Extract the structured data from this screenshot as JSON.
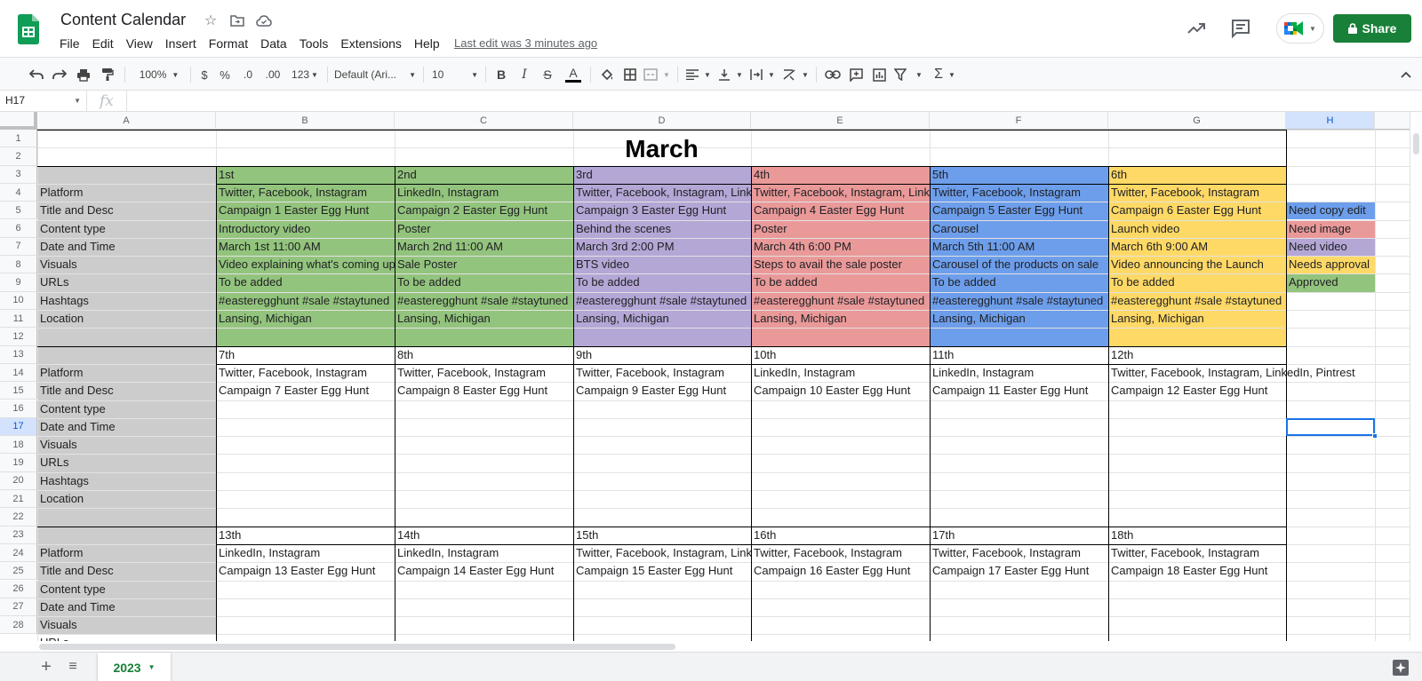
{
  "header": {
    "doc_title": "Content Calendar",
    "last_edit": "Last edit was 3 minutes ago",
    "share_label": "Share",
    "menu": [
      "File",
      "Edit",
      "View",
      "Insert",
      "Format",
      "Data",
      "Tools",
      "Extensions",
      "Help"
    ]
  },
  "toolbar": {
    "zoom": "100%",
    "currency": "$",
    "percent": "%",
    "dec_decrease": ".0",
    "dec_increase": ".00",
    "more_formats": "123",
    "font": "Default (Ari...",
    "font_size": "10",
    "bold": "B",
    "italic": "I",
    "strike": "S",
    "text_color": "A"
  },
  "formula_bar": {
    "cell_ref": "H17",
    "fx": "fx",
    "value": ""
  },
  "grid": {
    "columns": [
      "A",
      "B",
      "C",
      "D",
      "E",
      "F",
      "G",
      "H"
    ],
    "rows": [
      "1",
      "2",
      "3",
      "4",
      "5",
      "6",
      "7",
      "8",
      "9",
      "10",
      "11",
      "12",
      "13",
      "14",
      "15",
      "16",
      "17",
      "18",
      "19",
      "20",
      "21",
      "22",
      "23",
      "24",
      "25",
      "26",
      "27",
      "28"
    ],
    "title": "March",
    "row_labels": [
      "Platform",
      "Title and Desc",
      "Content type",
      "Date and Time",
      "Visuals",
      "URLs",
      "Hashtags",
      "Location"
    ],
    "row_label_block_rows": [
      4,
      14,
      24
    ],
    "colors": {
      "green": "#93c47d",
      "purple": "#b4a7d6",
      "red": "#ea9999",
      "blue": "#6d9eeb",
      "yellow": "#ffd966",
      "gray": "#cccccc",
      "selection": "#1a73e8",
      "brand_green": "#188038"
    },
    "week1": {
      "days": [
        {
          "date": "1st",
          "color": "green",
          "platform": "Twitter, Facebook, Instagram",
          "title": "Campaign 1 Easter Egg Hunt",
          "content_type": "Introductory video",
          "datetime": "March 1st 11:00 AM",
          "visuals": "Video explaining what's coming up",
          "urls": "To be added",
          "hashtags": "#easteregghunt #sale #staytuned",
          "location": "Lansing, Michigan"
        },
        {
          "date": "2nd",
          "color": "green",
          "platform": "LinkedIn, Instagram",
          "title": "Campaign 2 Easter Egg Hunt",
          "content_type": "Poster",
          "datetime": "March 2nd 11:00 AM",
          "visuals": "Sale Poster",
          "urls": "To be added",
          "hashtags": "#easteregghunt #sale #staytuned",
          "location": "Lansing, Michigan"
        },
        {
          "date": "3rd",
          "color": "purple",
          "platform": "Twitter, Facebook, Instagram, Link",
          "title": "Campaign 3 Easter Egg Hunt",
          "content_type": "Behind the scenes",
          "datetime": "March 3rd 2:00 PM",
          "visuals": "BTS video",
          "urls": "To be added",
          "hashtags": "#easteregghunt #sale #staytuned",
          "location": "Lansing, Michigan"
        },
        {
          "date": "4th",
          "color": "red",
          "platform": "Twitter, Facebook, Instagram, Link",
          "title": "Campaign 4 Easter Egg Hunt",
          "content_type": "Poster",
          "datetime": "March 4th 6:00 PM",
          "visuals": "Steps to avail the sale poster",
          "urls": "To be added",
          "hashtags": "#easteregghunt #sale #staytuned",
          "location": "Lansing, Michigan"
        },
        {
          "date": "5th",
          "color": "blue",
          "platform": "Twitter, Facebook, Instagram",
          "title": "Campaign 5 Easter Egg Hunt",
          "content_type": "Carousel",
          "datetime": "March 5th 11:00 AM",
          "visuals": "Carousel of the products on sale",
          "urls": "To be added",
          "hashtags": "#easteregghunt #sale #staytuned",
          "location": "Lansing, Michigan"
        },
        {
          "date": "6th",
          "color": "yellow",
          "platform": "Twitter, Facebook, Instagram",
          "title": "Campaign 6 Easter Egg Hunt",
          "content_type": "Launch video",
          "datetime": "March 6th 9:00 AM",
          "visuals": "Video announcing the Launch",
          "urls": "To be added",
          "hashtags": "#easteregghunt #sale #staytuned",
          "location": "Lansing, Michigan"
        }
      ]
    },
    "week2": {
      "days": [
        {
          "date": "7th",
          "platform": "Twitter, Facebook, Instagram",
          "title": "Campaign 7 Easter Egg Hunt"
        },
        {
          "date": "8th",
          "platform": "Twitter, Facebook, Instagram",
          "title": "Campaign 8 Easter Egg Hunt"
        },
        {
          "date": "9th",
          "platform": "Twitter, Facebook, Instagram",
          "title": "Campaign 9 Easter Egg Hunt"
        },
        {
          "date": "10th",
          "platform": "LinkedIn, Instagram",
          "title": "Campaign 10 Easter Egg Hunt"
        },
        {
          "date": "11th",
          "platform": "LinkedIn, Instagram",
          "title": "Campaign 11 Easter Egg Hunt"
        },
        {
          "date": "12th",
          "platform": "Twitter, Facebook, Instagram, LinkedIn, Pintrest",
          "title": "Campaign 12 Easter Egg Hunt"
        }
      ]
    },
    "week3": {
      "days": [
        {
          "date": "13th",
          "platform": "LinkedIn, Instagram",
          "title": "Campaign 13 Easter Egg Hunt"
        },
        {
          "date": "14th",
          "platform": "LinkedIn, Instagram",
          "title": "Campaign 14 Easter Egg Hunt"
        },
        {
          "date": "15th",
          "platform": "Twitter, Facebook, Instagram, Link",
          "title": "Campaign 15 Easter Egg Hunt"
        },
        {
          "date": "16th",
          "platform": "Twitter, Facebook, Instagram",
          "title": "Campaign 16 Easter Egg Hunt"
        },
        {
          "date": "17th",
          "platform": "Twitter, Facebook, Instagram",
          "title": "Campaign 17 Easter Egg Hunt"
        },
        {
          "date": "18th",
          "platform": "Twitter, Facebook, Instagram",
          "title": "Campaign 18 Easter Egg Hunt"
        }
      ]
    },
    "legend": [
      {
        "label": "Need copy edit",
        "color": "blue"
      },
      {
        "label": "Need image",
        "color": "red"
      },
      {
        "label": "Need video",
        "color": "purple"
      },
      {
        "label": "Needs approval",
        "color": "yellow"
      },
      {
        "label": "Approved",
        "color": "green"
      }
    ]
  },
  "sheets": {
    "active": "2023"
  }
}
